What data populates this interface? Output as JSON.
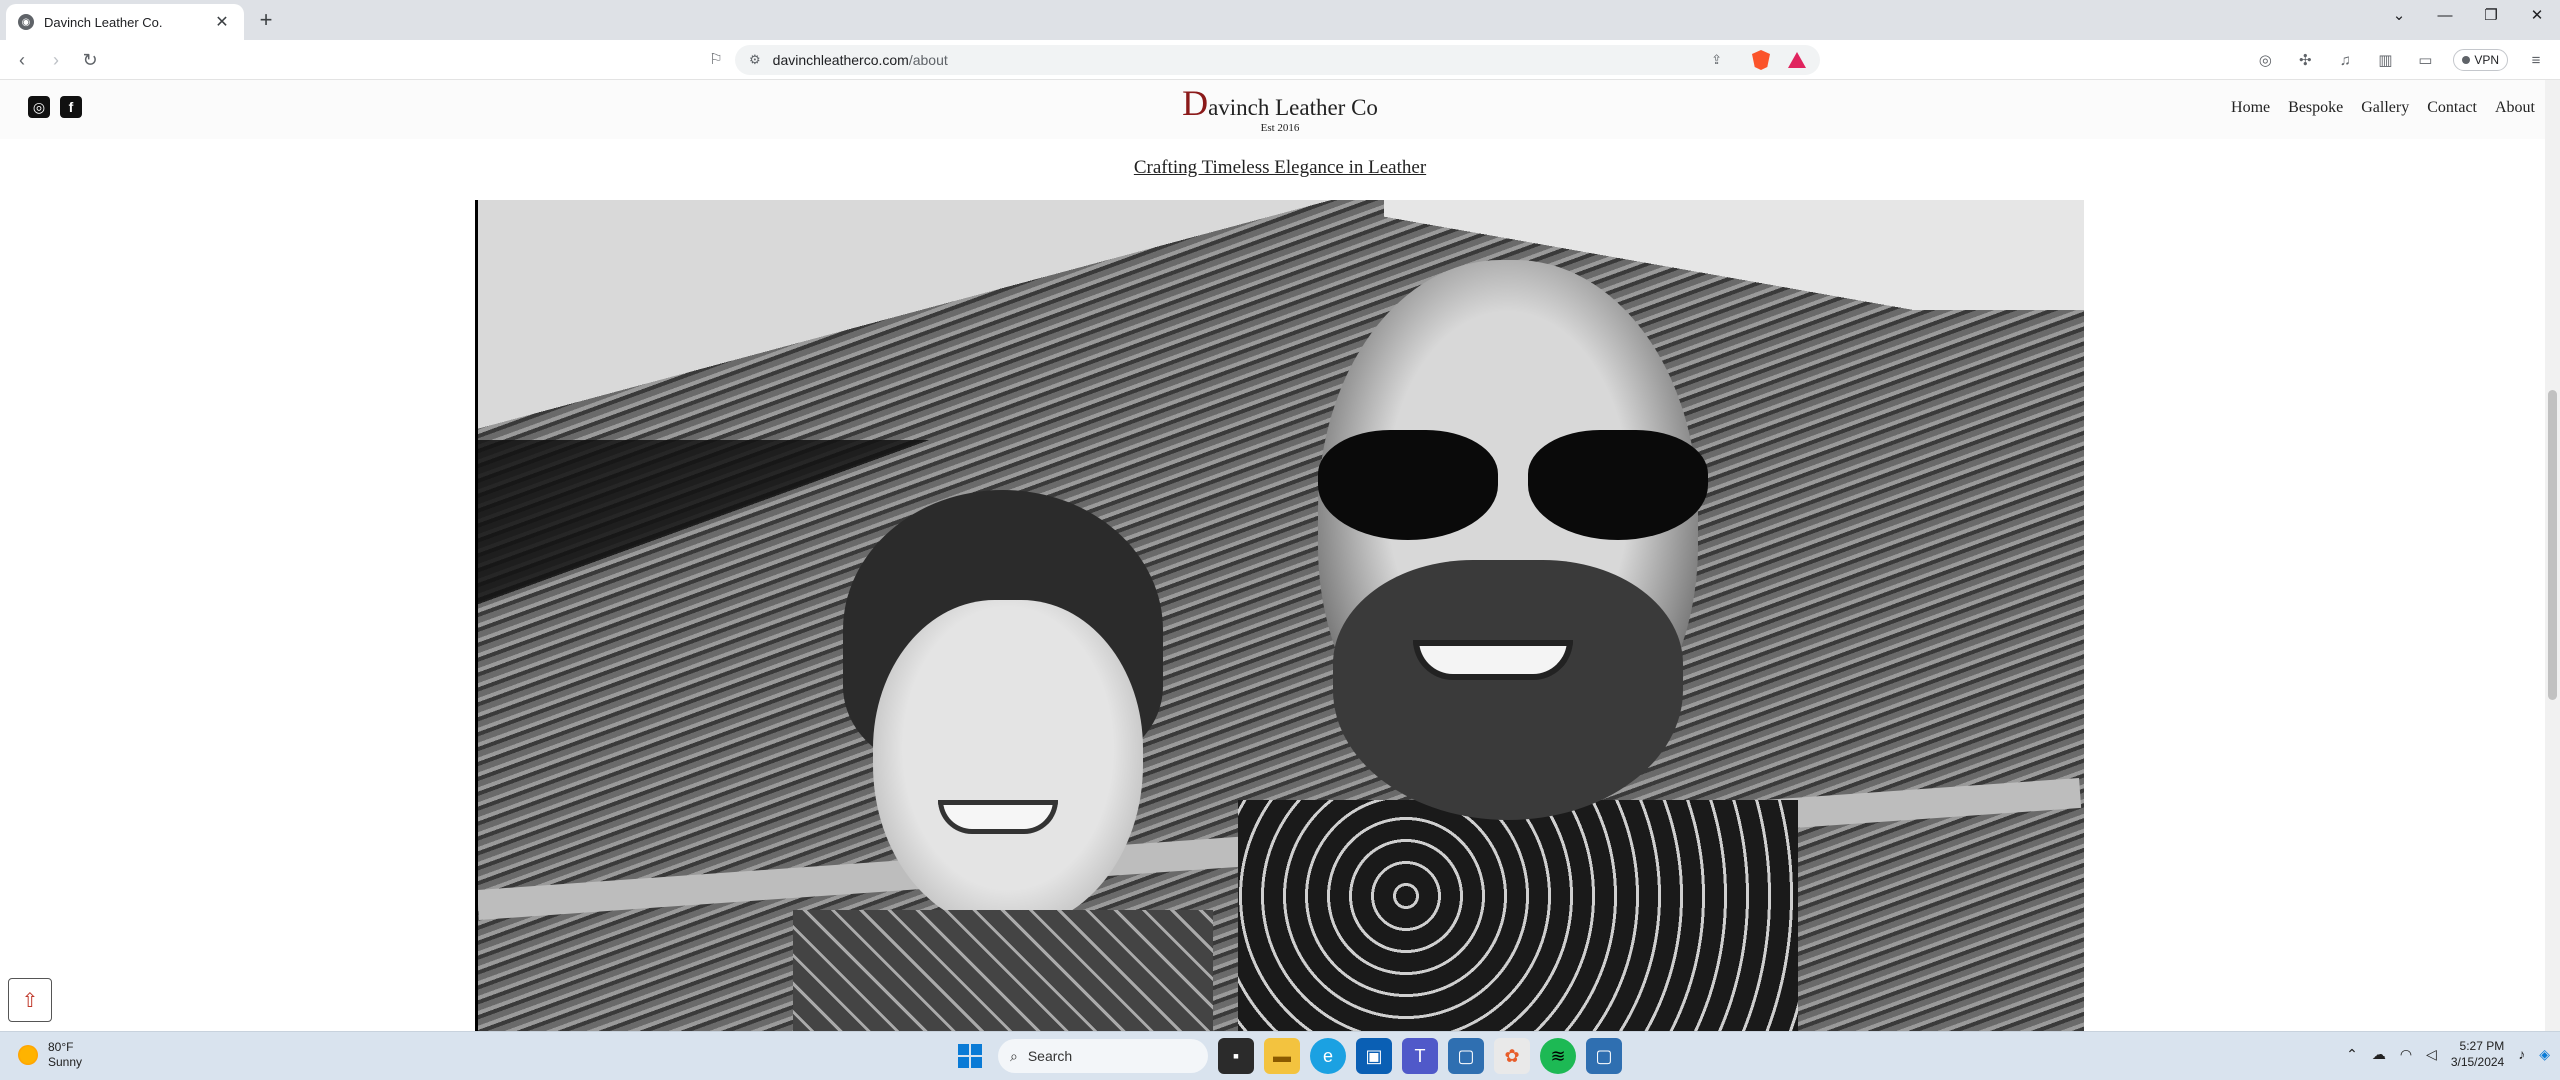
{
  "browser": {
    "tab_title": "Davinch Leather Co.",
    "tab_close": "✕",
    "new_tab": "+",
    "window_controls": {
      "dropdown": "⌄",
      "minimize": "—",
      "restore": "❐",
      "close": "✕"
    },
    "url_domain": "davinchleatherco.com",
    "url_path": "/about",
    "vpn_label": "VPN"
  },
  "site": {
    "logo_initial": "D",
    "logo_rest": "avinch Leather Co",
    "logo_sub": "Est 2016",
    "social_icons": [
      "instagram-icon",
      "facebook-icon"
    ],
    "nav": [
      "Home",
      "Bespoke",
      "Gallery",
      "Contact",
      "About"
    ],
    "headline": "Crafting Timeless Elegance in Leather"
  },
  "taskbar": {
    "weather_temp": "80°F",
    "weather_desc": "Sunny",
    "search_label": "Search",
    "time": "5:27 PM",
    "date": "3/15/2024"
  },
  "colors": {
    "logo_initial": "#8b1a1a",
    "windows_blue": "#0a7bd6",
    "brave_orange": "#fb542b"
  }
}
